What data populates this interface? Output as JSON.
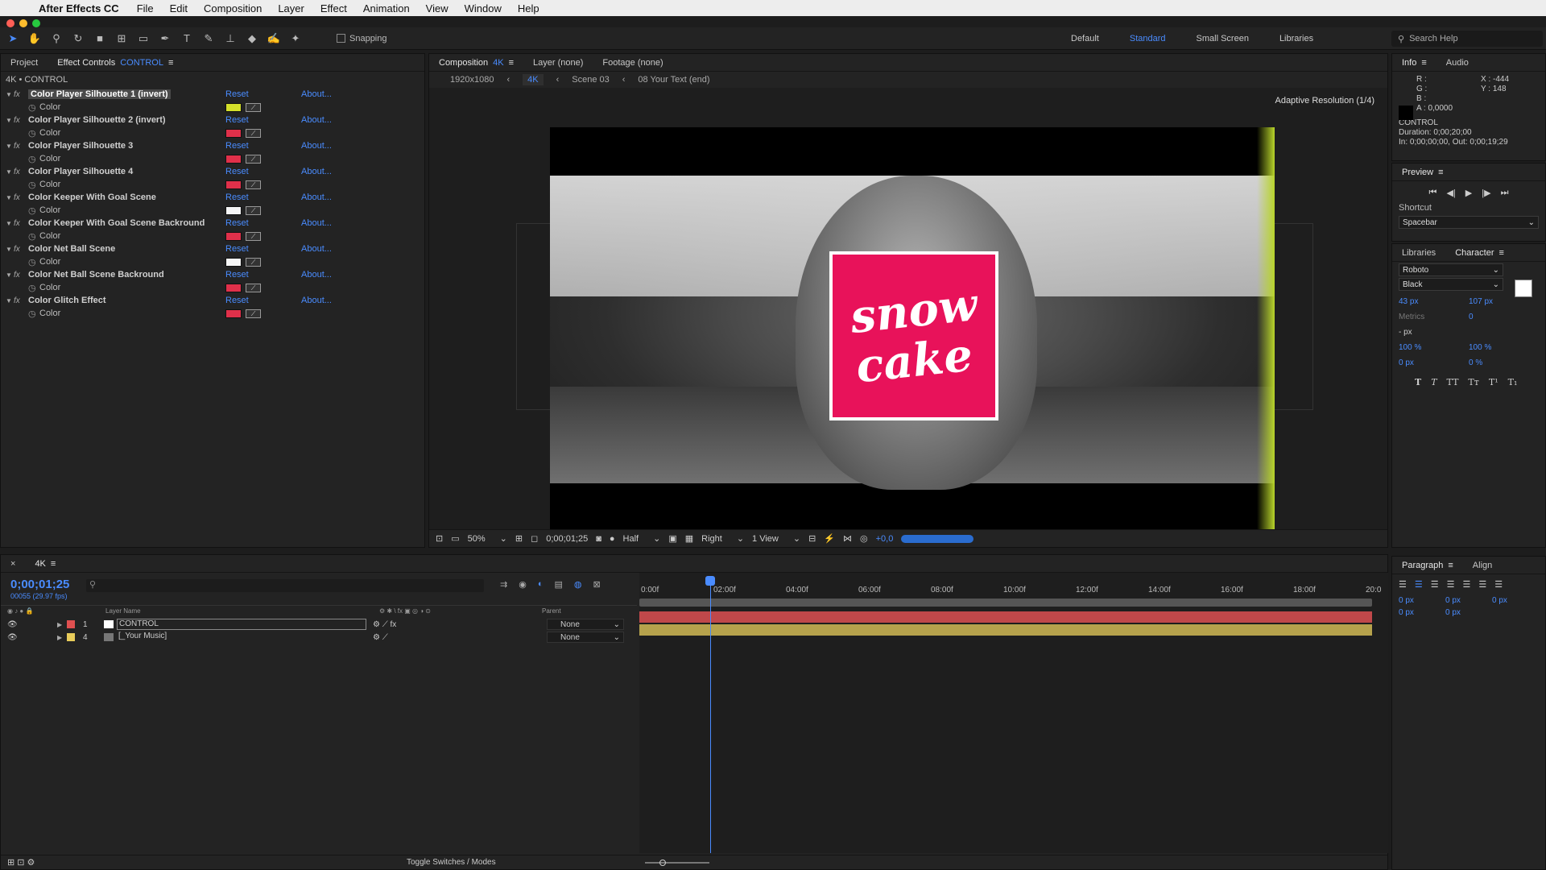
{
  "menubar": {
    "app_name": "After Effects CC",
    "items": [
      "File",
      "Edit",
      "Composition",
      "Layer",
      "Effect",
      "Animation",
      "View",
      "Window",
      "Help"
    ]
  },
  "toolbar": {
    "snapping_label": "Snapping",
    "workspaces": [
      "Default",
      "Standard",
      "Small Screen",
      "Libraries"
    ],
    "active_workspace": "Standard",
    "search_help_placeholder": "Search Help"
  },
  "effect_controls": {
    "project_tab": "Project",
    "tab_label": "Effect Controls",
    "tab_target": "CONTROL",
    "subtitle": "4K • CONTROL",
    "reset_label": "Reset",
    "about_label": "About...",
    "color_label": "Color",
    "effects": [
      {
        "name": "Color Player Silhouette 1 (invert)",
        "color": "#d4e02a",
        "highlighted": true
      },
      {
        "name": "Color Player Silhouette 2 (invert)",
        "color": "#e0304a",
        "highlighted": false
      },
      {
        "name": "Color Player Silhouette 3",
        "color": "#e0304a",
        "highlighted": false
      },
      {
        "name": "Color Player Silhouette 4",
        "color": "#e0304a",
        "highlighted": false
      },
      {
        "name": "Color Keeper With Goal Scene",
        "color": "#f5f5f5",
        "highlighted": false
      },
      {
        "name": "Color Keeper With Goal Scene Backround",
        "color": "#e0304a",
        "highlighted": false
      },
      {
        "name": "Color Net Ball Scene",
        "color": "#f5f5f5",
        "highlighted": false
      },
      {
        "name": "Color Net Ball Scene Backround",
        "color": "#e0304a",
        "highlighted": false
      },
      {
        "name": "Color Glitch Effect",
        "color": "#e0304a",
        "highlighted": false
      }
    ]
  },
  "composition": {
    "tab_label": "Composition",
    "tab_name": "4K",
    "layer_tab": "Layer (none)",
    "footage_tab": "Footage (none)",
    "crumbs": [
      "1920x1080",
      "4K",
      "Scene 03",
      "08 Your Text (end)"
    ],
    "adaptive_resolution": "Adaptive Resolution (1/4)",
    "logo_line1": "snow",
    "logo_line2": "cake",
    "logo_color": "#e8125a",
    "zoom": "50%",
    "timecode": "0;00;01;25",
    "resolution": "Half",
    "view": "Right",
    "views": "1 View",
    "exposure": "+0,0"
  },
  "info": {
    "tab": "Info",
    "audio_tab": "Audio",
    "r": "R :",
    "g": "G :",
    "b": "B :",
    "a": "A : 0,0000",
    "x": "X : -444",
    "y": "Y : 148",
    "layer": "CONTROL",
    "duration": "Duration: 0;00;20;00",
    "in_out": "In: 0;00;00;00, Out: 0;00;19;29"
  },
  "preview": {
    "tab": "Preview",
    "shortcut_label": "Shortcut",
    "shortcut_value": "Spacebar"
  },
  "character": {
    "libraries_tab": "Libraries",
    "tab": "Character",
    "font": "Roboto",
    "style": "Black",
    "size": "43 px",
    "leading": "107 px",
    "kerning": "Metrics",
    "tracking": "0",
    "stroke": "- px",
    "vscale": "100 %",
    "hscale": "100 %",
    "baseline": "0 px",
    "tsume": "0 %"
  },
  "paragraph": {
    "tab": "Paragraph",
    "align_tab": "Align",
    "indent_left": "0 px",
    "indent_right": "0 px",
    "indent_first": "0 px",
    "space_before": "0 px",
    "space_after": "0 px"
  },
  "timeline": {
    "tab": "4K",
    "timecode": "0;00;01;25",
    "fps": "00055 (29.97 fps)",
    "col_layer_name": "Layer Name",
    "col_parent": "Parent",
    "ruler_ticks": [
      "0:00f",
      "02:00f",
      "04:00f",
      "06:00f",
      "08:00f",
      "10:00f",
      "12:00f",
      "14:00f",
      "16:00f",
      "18:00f",
      "20:0"
    ],
    "layers": [
      {
        "num": "1",
        "name": "CONTROL",
        "label_color": "#e05050",
        "parent": "None",
        "bar_color": "#c0484a"
      },
      {
        "num": "4",
        "name": "[_Your Music]",
        "label_color": "#e8cc5a",
        "parent": "None",
        "bar_color": "#b6a24c"
      }
    ],
    "toggle_label": "Toggle Switches / Modes"
  }
}
